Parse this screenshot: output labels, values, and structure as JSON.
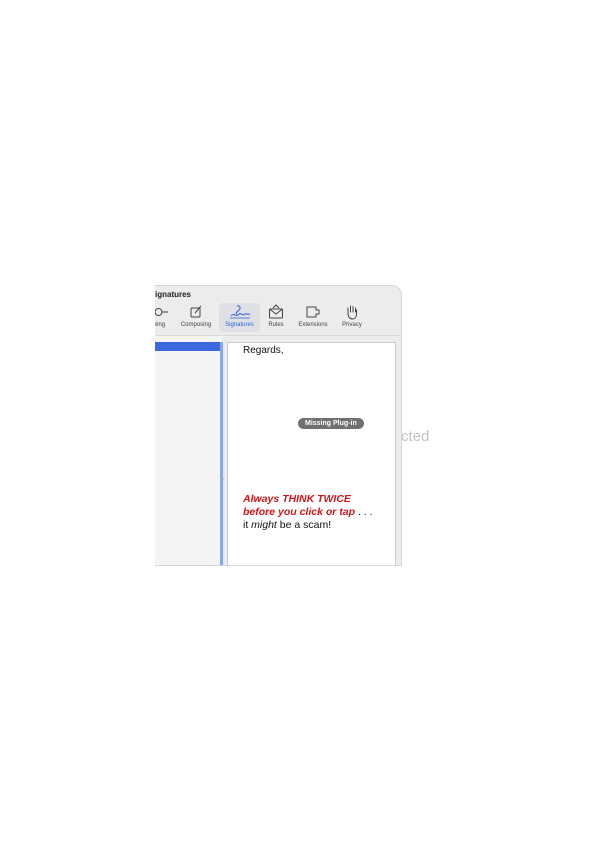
{
  "window": {
    "title": "ignatures"
  },
  "toolbar": {
    "items": [
      {
        "label": "wing",
        "icon": "viewing-icon"
      },
      {
        "label": "Composing",
        "icon": "compose-icon"
      },
      {
        "label": "Signatures",
        "icon": "signature-icon",
        "selected": true
      },
      {
        "label": "Rules",
        "icon": "rules-icon"
      },
      {
        "label": "Extensions",
        "icon": "extensions-icon"
      },
      {
        "label": "Privacy",
        "icon": "privacy-hand-icon"
      }
    ],
    "accent_color": "#2d62d6"
  },
  "background_text": "cted",
  "preview": {
    "greeting": "Regards,",
    "plugin_badge": "Missing Plug-in",
    "signature": {
      "line1": "Always THINK TWICE",
      "line2": "before you click or tap",
      "line2_tail": " . . .",
      "line3_a": "it ",
      "line3_b": "might",
      "line3_c": " be a scam!",
      "red_color": "#d0161a"
    }
  },
  "list": {
    "selection_color": "#3c68dd"
  }
}
